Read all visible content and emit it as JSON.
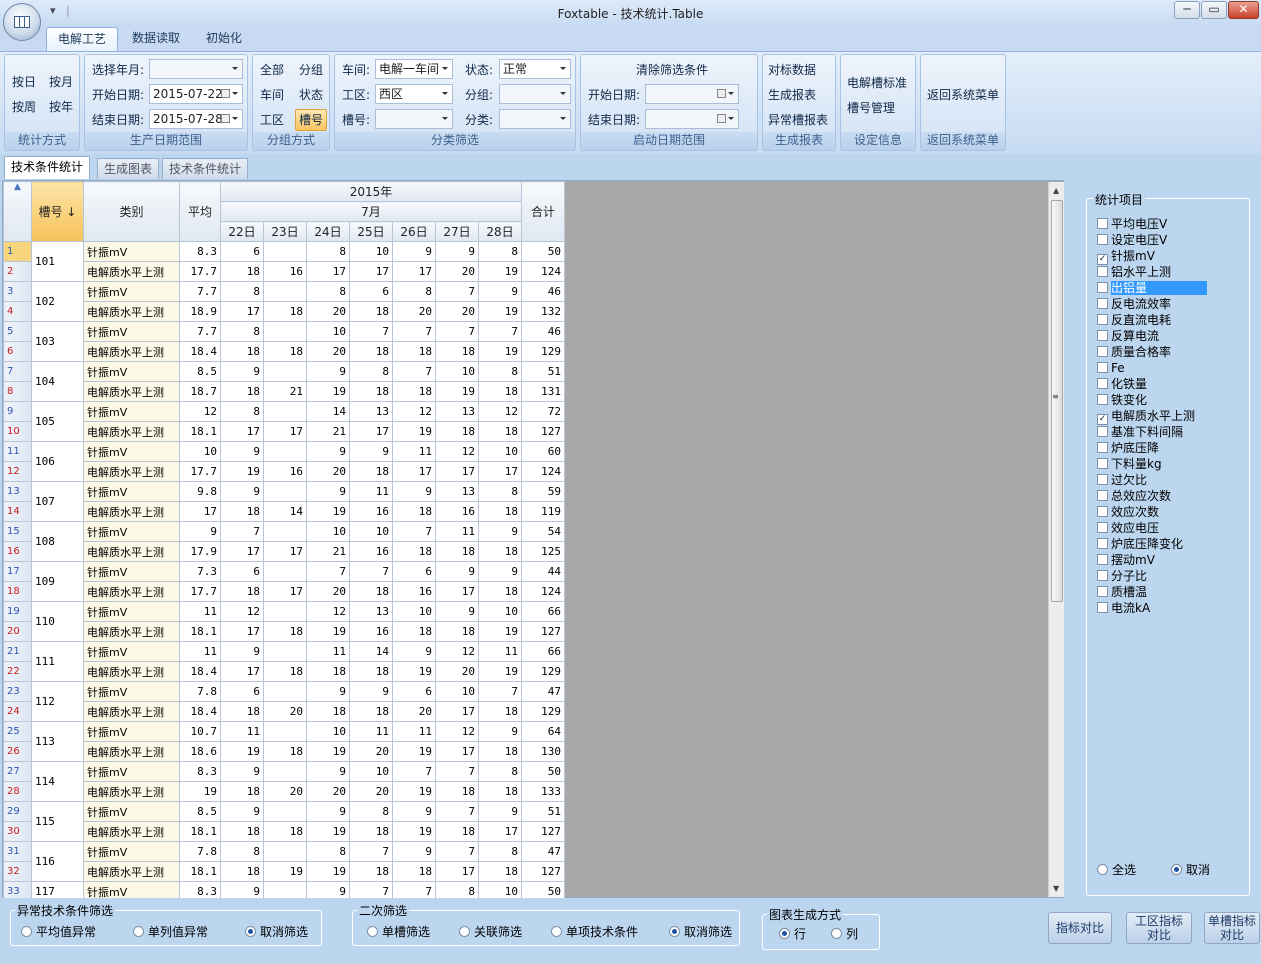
{
  "window": {
    "title": "Foxtable - 技术统计.Table",
    "qat": [
      "▾",
      "|"
    ],
    "min": "─",
    "max": "▭",
    "close": "✕"
  },
  "ribbon_tabs": [
    "电解工艺",
    "数据读取",
    "初始化"
  ],
  "groups": {
    "stat_mode": {
      "label": "统计方式",
      "buttons": [
        "按日",
        "按月",
        "按周",
        "按年"
      ]
    },
    "date_range": {
      "label": "生产日期范围",
      "year_month_label": "选择年月:",
      "year_month_value": "",
      "start_label": "开始日期:",
      "start_value": "2015-07-22",
      "end_label": "结束日期:",
      "end_value": "2015-07-28"
    },
    "group_mode": {
      "label": "分组方式",
      "buttons": [
        "全部",
        "分组",
        "车间",
        "状态",
        "工区",
        "槽号"
      ]
    },
    "class_filter": {
      "label": "分类筛选",
      "workshop_label": "车间:",
      "workshop_value": "电解一车间",
      "status_label": "状态:",
      "status_value": "正常",
      "area_label": "工区:",
      "area_value": "西区",
      "group_label": "分组:",
      "group_value": "",
      "slot_label": "槽号:",
      "slot_value": "",
      "type_label": "分类:",
      "type_value": ""
    },
    "start_date": {
      "label": "启动日期范围",
      "clear": "清除筛选条件",
      "start_label": "开始日期:",
      "end_label": "结束日期:"
    },
    "report": {
      "label": "生成报表",
      "buttons": [
        "对标数据",
        "生成报表",
        "异常槽报表"
      ]
    },
    "settings": {
      "label": "设定信息",
      "buttons": [
        "电解槽标准",
        "槽号管理"
      ]
    },
    "back": {
      "label": "返回系统菜单",
      "button": "返回系统菜单"
    }
  },
  "doc_tabs": [
    "技术条件统计",
    "生成图表",
    "技术条件统计"
  ],
  "grid": {
    "corner": "▲",
    "h_slot": "槽号",
    "h_sort": "↓",
    "h_cat": "类别",
    "h_avg": "平均",
    "h_year": "2015年",
    "h_month": "7月",
    "h_total": "合计",
    "days": [
      "22日",
      "23日",
      "24日",
      "25日",
      "26日",
      "27日",
      "28日"
    ],
    "rows": [
      {
        "slot": "101",
        "a": {
          "cat": "针振mV",
          "avg": "8.3",
          "d": [
            "6",
            "",
            "8",
            "10",
            "9",
            "9",
            "8"
          ],
          "tot": "50"
        },
        "b": {
          "cat": "电解质水平上测",
          "avg": "17.7",
          "d": [
            "18",
            "16",
            "17",
            "17",
            "17",
            "20",
            "19"
          ],
          "tot": "124"
        }
      },
      {
        "slot": "102",
        "a": {
          "cat": "针振mV",
          "avg": "7.7",
          "d": [
            "8",
            "",
            "8",
            "6",
            "8",
            "7",
            "9"
          ],
          "tot": "46"
        },
        "b": {
          "cat": "电解质水平上测",
          "avg": "18.9",
          "d": [
            "17",
            "18",
            "20",
            "18",
            "20",
            "20",
            "19"
          ],
          "tot": "132"
        }
      },
      {
        "slot": "103",
        "a": {
          "cat": "针振mV",
          "avg": "7.7",
          "d": [
            "8",
            "",
            "10",
            "7",
            "7",
            "7",
            "7"
          ],
          "tot": "46"
        },
        "b": {
          "cat": "电解质水平上测",
          "avg": "18.4",
          "d": [
            "18",
            "18",
            "20",
            "18",
            "18",
            "18",
            "19"
          ],
          "tot": "129"
        }
      },
      {
        "slot": "104",
        "a": {
          "cat": "针振mV",
          "avg": "8.5",
          "d": [
            "9",
            "",
            "9",
            "8",
            "7",
            "10",
            "8"
          ],
          "tot": "51"
        },
        "b": {
          "cat": "电解质水平上测",
          "avg": "18.7",
          "d": [
            "18",
            "21",
            "19",
            "18",
            "18",
            "19",
            "18"
          ],
          "tot": "131"
        }
      },
      {
        "slot": "105",
        "a": {
          "cat": "针振mV",
          "avg": "12",
          "d": [
            "8",
            "",
            "14",
            "13",
            "12",
            "13",
            "12"
          ],
          "tot": "72"
        },
        "b": {
          "cat": "电解质水平上测",
          "avg": "18.1",
          "d": [
            "17",
            "17",
            "21",
            "17",
            "19",
            "18",
            "18"
          ],
          "tot": "127"
        }
      },
      {
        "slot": "106",
        "a": {
          "cat": "针振mV",
          "avg": "10",
          "d": [
            "9",
            "",
            "9",
            "9",
            "11",
            "12",
            "10"
          ],
          "tot": "60"
        },
        "b": {
          "cat": "电解质水平上测",
          "avg": "17.7",
          "d": [
            "19",
            "16",
            "20",
            "18",
            "17",
            "17",
            "17"
          ],
          "tot": "124"
        }
      },
      {
        "slot": "107",
        "a": {
          "cat": "针振mV",
          "avg": "9.8",
          "d": [
            "9",
            "",
            "9",
            "11",
            "9",
            "13",
            "8"
          ],
          "tot": "59"
        },
        "b": {
          "cat": "电解质水平上测",
          "avg": "17",
          "d": [
            "18",
            "14",
            "19",
            "16",
            "18",
            "16",
            "18"
          ],
          "tot": "119"
        }
      },
      {
        "slot": "108",
        "a": {
          "cat": "针振mV",
          "avg": "9",
          "d": [
            "7",
            "",
            "10",
            "10",
            "7",
            "11",
            "9"
          ],
          "tot": "54"
        },
        "b": {
          "cat": "电解质水平上测",
          "avg": "17.9",
          "d": [
            "17",
            "17",
            "21",
            "16",
            "18",
            "18",
            "18"
          ],
          "tot": "125"
        }
      },
      {
        "slot": "109",
        "a": {
          "cat": "针振mV",
          "avg": "7.3",
          "d": [
            "6",
            "",
            "7",
            "7",
            "6",
            "9",
            "9"
          ],
          "tot": "44"
        },
        "b": {
          "cat": "电解质水平上测",
          "avg": "17.7",
          "d": [
            "18",
            "17",
            "20",
            "18",
            "16",
            "17",
            "18"
          ],
          "tot": "124"
        }
      },
      {
        "slot": "110",
        "a": {
          "cat": "针振mV",
          "avg": "11",
          "d": [
            "12",
            "",
            "12",
            "13",
            "10",
            "9",
            "10"
          ],
          "tot": "66"
        },
        "b": {
          "cat": "电解质水平上测",
          "avg": "18.1",
          "d": [
            "17",
            "18",
            "19",
            "16",
            "18",
            "18",
            "19"
          ],
          "tot": "127"
        }
      },
      {
        "slot": "111",
        "a": {
          "cat": "针振mV",
          "avg": "11",
          "d": [
            "9",
            "",
            "11",
            "14",
            "9",
            "12",
            "11"
          ],
          "tot": "66"
        },
        "b": {
          "cat": "电解质水平上测",
          "avg": "18.4",
          "d": [
            "17",
            "18",
            "18",
            "18",
            "19",
            "20",
            "19"
          ],
          "tot": "129"
        }
      },
      {
        "slot": "112",
        "a": {
          "cat": "针振mV",
          "avg": "7.8",
          "d": [
            "6",
            "",
            "9",
            "9",
            "6",
            "10",
            "7"
          ],
          "tot": "47"
        },
        "b": {
          "cat": "电解质水平上测",
          "avg": "18.4",
          "d": [
            "18",
            "20",
            "18",
            "18",
            "20",
            "17",
            "18"
          ],
          "tot": "129"
        }
      },
      {
        "slot": "113",
        "a": {
          "cat": "针振mV",
          "avg": "10.7",
          "d": [
            "11",
            "",
            "10",
            "11",
            "11",
            "12",
            "9"
          ],
          "tot": "64"
        },
        "b": {
          "cat": "电解质水平上测",
          "avg": "18.6",
          "d": [
            "19",
            "18",
            "19",
            "20",
            "19",
            "17",
            "18"
          ],
          "tot": "130"
        }
      },
      {
        "slot": "114",
        "a": {
          "cat": "针振mV",
          "avg": "8.3",
          "d": [
            "9",
            "",
            "9",
            "10",
            "7",
            "7",
            "8"
          ],
          "tot": "50"
        },
        "b": {
          "cat": "电解质水平上测",
          "avg": "19",
          "d": [
            "18",
            "20",
            "20",
            "20",
            "19",
            "18",
            "18"
          ],
          "tot": "133"
        }
      },
      {
        "slot": "115",
        "a": {
          "cat": "针振mV",
          "avg": "8.5",
          "d": [
            "9",
            "",
            "9",
            "8",
            "9",
            "7",
            "9"
          ],
          "tot": "51"
        },
        "b": {
          "cat": "电解质水平上测",
          "avg": "18.1",
          "d": [
            "18",
            "18",
            "19",
            "18",
            "19",
            "18",
            "17"
          ],
          "tot": "127"
        }
      },
      {
        "slot": "116",
        "a": {
          "cat": "针振mV",
          "avg": "7.8",
          "d": [
            "8",
            "",
            "8",
            "7",
            "9",
            "7",
            "8"
          ],
          "tot": "47"
        },
        "b": {
          "cat": "电解质水平上测",
          "avg": "18.1",
          "d": [
            "18",
            "19",
            "19",
            "18",
            "18",
            "17",
            "18"
          ],
          "tot": "127"
        }
      },
      {
        "slot": "117",
        "a": {
          "cat": "针振mV",
          "avg": "8.3",
          "d": [
            "9",
            "",
            "9",
            "7",
            "7",
            "8",
            "10"
          ],
          "tot": "50"
        },
        "b": null
      }
    ]
  },
  "stat_items": {
    "legend": "统计项目",
    "items": [
      {
        "label": "平均电压V",
        "checked": false
      },
      {
        "label": "设定电压V",
        "checked": false
      },
      {
        "label": "针振mV",
        "checked": true
      },
      {
        "label": "铝水平上测",
        "checked": false
      },
      {
        "label": "出铝量",
        "checked": false,
        "highlight": true
      },
      {
        "label": "反电流效率",
        "checked": false
      },
      {
        "label": "反直流电耗",
        "checked": false
      },
      {
        "label": "反算电流",
        "checked": false
      },
      {
        "label": "质量合格率",
        "checked": false
      },
      {
        "label": "Fe",
        "checked": false
      },
      {
        "label": "化铁量",
        "checked": false
      },
      {
        "label": "铁变化",
        "checked": false
      },
      {
        "label": "电解质水平上测",
        "checked": true
      },
      {
        "label": "基准下料间隔",
        "checked": false
      },
      {
        "label": "炉底压降",
        "checked": false
      },
      {
        "label": "下料量kg",
        "checked": false
      },
      {
        "label": "过欠比",
        "checked": false
      },
      {
        "label": "总效应次数",
        "checked": false
      },
      {
        "label": "效应次数",
        "checked": false
      },
      {
        "label": "效应电压",
        "checked": false
      },
      {
        "label": "炉底压降变化",
        "checked": false
      },
      {
        "label": "摆动mV",
        "checked": false
      },
      {
        "label": "分子比",
        "checked": false
      },
      {
        "label": "质槽温",
        "checked": false
      },
      {
        "label": "电流kA",
        "checked": false
      }
    ],
    "select_all": "全选",
    "cancel": "取消"
  },
  "bottom": {
    "abnormal": {
      "legend": "异常技术条件筛选",
      "opts": [
        "平均值异常",
        "单列值异常",
        "取消筛选"
      ],
      "selected": 2
    },
    "secondary": {
      "legend": "二次筛选",
      "opts": [
        "单槽筛选",
        "关联筛选",
        "单项技术条件",
        "取消筛选"
      ],
      "selected": 3
    },
    "chart": {
      "legend": "图表生成方式",
      "opts": [
        "行",
        "列"
      ],
      "selected": 0
    },
    "btn_compare": "指标对比",
    "btn_area_l1": "工区指标",
    "btn_area_l2": "对比",
    "btn_single_l1": "单槽指标",
    "btn_single_l2": "对比"
  }
}
